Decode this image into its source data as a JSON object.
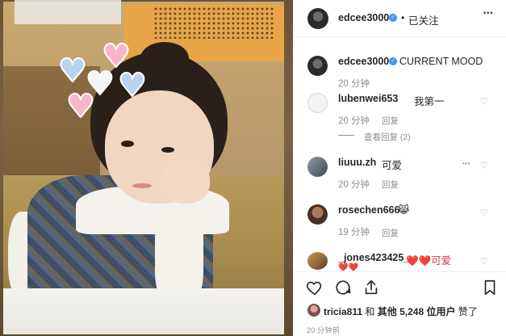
{
  "header": {
    "username": "edcee3000",
    "verified_mark": "✓",
    "separator": "•",
    "follow_status": "已关注",
    "more_label": "•••"
  },
  "caption": {
    "username": "edcee3000",
    "verified_mark": "✓",
    "text": "CURRENT MOOD",
    "time": "20 分钟"
  },
  "comments": [
    {
      "username": "lubenwei653",
      "text": "我第一",
      "time": "20 分钟",
      "reply_label": "回复",
      "view_replies": "查看回复 (2)",
      "like_icon": "heart-outline-icon"
    },
    {
      "username": "liuuu.zh",
      "text": "可爱",
      "time": "20 分钟",
      "reply_label": "回复",
      "more_label": "•••",
      "like_icon": "heart-outline-icon"
    },
    {
      "username": "rosechen666",
      "text": "😹",
      "time": "19 分钟",
      "reply_label": "回复",
      "like_icon": "heart-outline-icon"
    },
    {
      "username": "_jones423425_",
      "text": "❤️❤️可爱",
      "extra": "❤️❤️",
      "like_icon": "heart-outline-icon"
    }
  ],
  "actions": {
    "icons": [
      "heart-outline-icon",
      "comment-icon",
      "share-icon",
      "bookmark-icon"
    ]
  },
  "likes": {
    "first_user": "tricia811",
    "conj": "和",
    "others": "其他 5,248 位用户",
    "suffix": "赞了"
  },
  "timestamp": "20 分钟前",
  "colors": {
    "verified": "#3897f0",
    "text": "#262626",
    "muted": "#8e8e8e",
    "border": "#efefef",
    "heart_pink": "#f6b6c8",
    "heart_blue": "#b8d3ef"
  },
  "photo": {
    "stickers": [
      "heart",
      "heart",
      "heart",
      "heart",
      "heart"
    ]
  }
}
